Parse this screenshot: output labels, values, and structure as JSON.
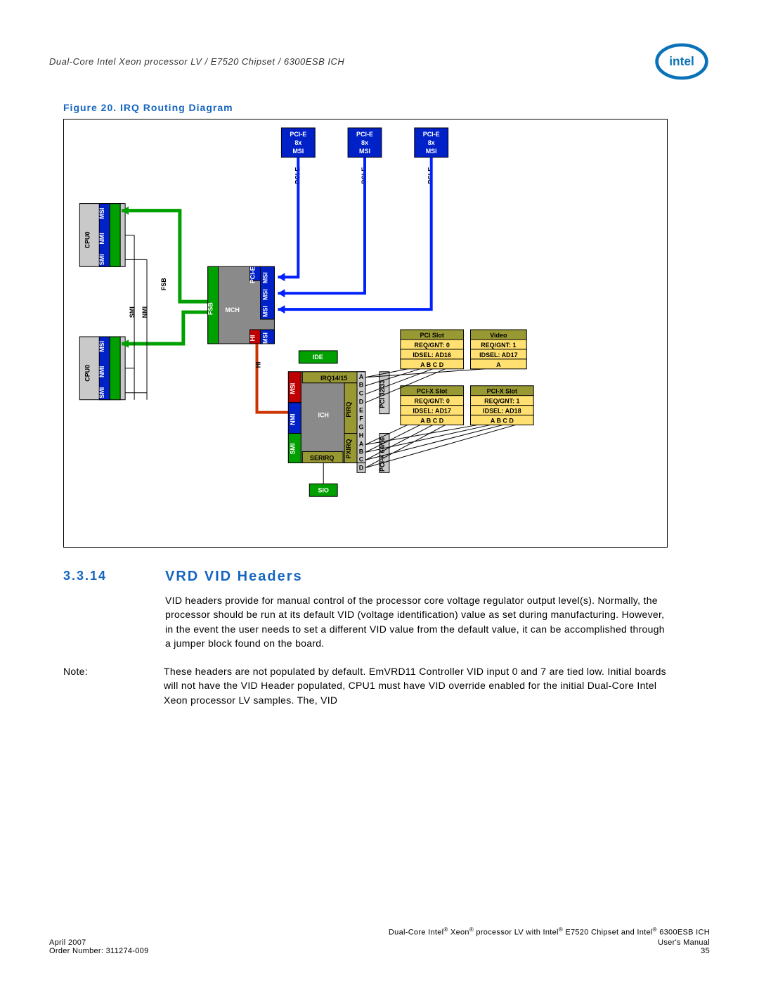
{
  "header": {
    "running_title": "Dual-Core Intel Xeon processor LV / E7520 Chipset / 6300ESB ICH",
    "logo_label": "intel"
  },
  "figure": {
    "caption": "Figure 20.   IRQ Routing Diagram",
    "pcie_top": [
      {
        "l1": "PCI-E",
        "l2": "8x",
        "l3": "MSI"
      },
      {
        "l1": "PCI-E",
        "l2": "8x",
        "l3": "MSI"
      },
      {
        "l1": "PCI-E",
        "l2": "8x",
        "l3": "MSI"
      }
    ],
    "pcie_bus_label": "PCI-E",
    "cpu": {
      "name": "CPU0",
      "lanes": [
        "MSI",
        "NMI",
        "SMI"
      ]
    },
    "cpu_sig": {
      "smi": "SMI",
      "nmi": "NMI",
      "fsb": "FSB"
    },
    "mch": {
      "fsb": "FSB",
      "name": "MCH",
      "pcie": "PCI-E",
      "msi": [
        "MSI",
        "MSI",
        "MSI"
      ],
      "hi": "HI",
      "msi_hi": "MSI"
    },
    "hi_label": "HI",
    "ich": {
      "name": "ICH",
      "ide": "IDE",
      "irq": "IRQ14/15",
      "msi": "MSI",
      "nmi": "NMI",
      "smi": "SMI",
      "pirq": "PIRQ",
      "pxirq": "PXIRQ",
      "serirq": "SERIRQ",
      "sio": "SIO",
      "pirq_lanes": [
        "A",
        "B",
        "C",
        "D",
        "E",
        "F",
        "G",
        "H"
      ],
      "pxirq_lanes": [
        "A",
        "B",
        "C",
        "D"
      ],
      "pci_bus1": "PCI 32/33",
      "pci_bus2": "PCI-X 64/66"
    },
    "slots": {
      "pci_slot": {
        "t": "PCI Slot",
        "r": "REQ/GNT: 0",
        "i": "IDSEL: AD16",
        "abcd": "A  B  C  D"
      },
      "video": {
        "t": "Video",
        "r": "REQ/GNT: 1",
        "i": "IDSEL: AD17",
        "abcd": "A"
      },
      "pcix1": {
        "t": "PCI-X Slot",
        "r": "REQ/GNT: 0",
        "i": "IDSEL: AD17",
        "abcd": "A  B  C  D"
      },
      "pcix2": {
        "t": "PCI-X Slot",
        "r": "REQ/GNT: 1",
        "i": "IDSEL: AD18",
        "abcd": "A  B  C  D"
      }
    }
  },
  "section": {
    "num": "3.3.14",
    "title": "VRD VID Headers",
    "body": "VID headers provide for manual control of the processor core voltage regulator output level(s). Normally, the processor should be run at its default VID (voltage identification) value as set during manufacturing. However, in the event the user needs to set a different VID value from the default value, it can be accomplished through a jumper block found on the board.",
    "note_label": "Note:",
    "note_body": "These headers are not populated by default. EmVRD11 Controller VID input 0 and 7 are tied low. Initial boards will not have the VID Header populated, CPU1 must have VID override enabled for the initial Dual-Core Intel Xeon processor LV samples. The, VID"
  },
  "footer": {
    "line1_a": "Dual-Core Intel",
    "line1_b": " Xeon",
    "line1_c": " processor LV with Intel",
    "line1_d": " E7520 Chipset and Intel",
    "line1_e": " 6300ESB ICH",
    "date": "April 2007",
    "manual": "User's Manual",
    "order": "Order Number: 311274-009",
    "page": "35"
  }
}
